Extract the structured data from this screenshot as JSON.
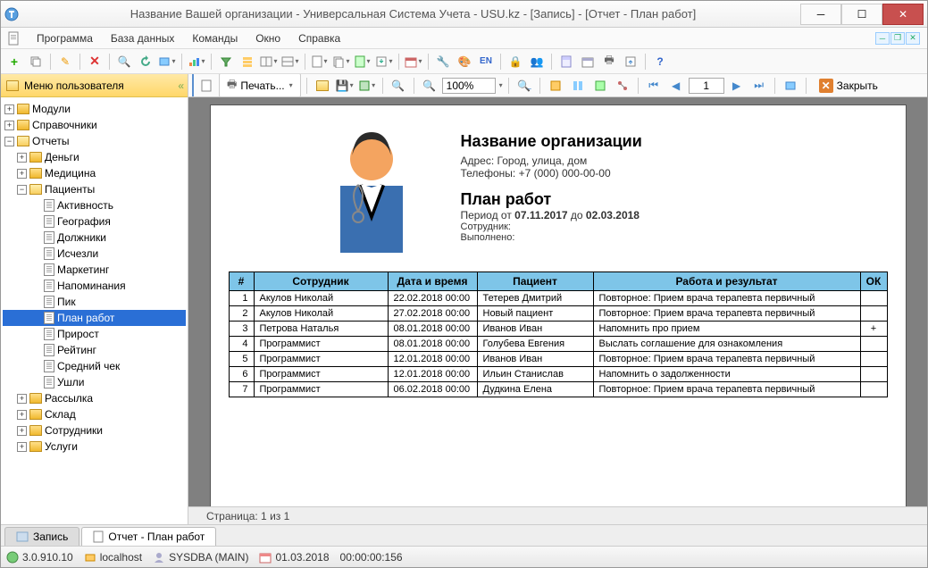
{
  "window": {
    "title": "Название Вашей организации - Универсальная Система Учета - USU.kz - [Запись] - [Отчет - План работ]"
  },
  "menu": [
    "Программа",
    "База данных",
    "Команды",
    "Окно",
    "Справка"
  ],
  "sidebar": {
    "title": "Меню пользователя",
    "nodes": {
      "modules": "Модули",
      "refs": "Справочники",
      "reports": "Отчеты",
      "money": "Деньги",
      "medicine": "Медицина",
      "patients": "Пациенты",
      "activity": "Активность",
      "geo": "География",
      "debtors": "Должники",
      "gone": "Исчезли",
      "marketing": "Маркетинг",
      "reminders": "Напоминания",
      "peak": "Пик",
      "plan": "План работ",
      "growth": "Прирост",
      "rating": "Рейтинг",
      "avgcheck": "Средний чек",
      "left": "Ушли",
      "mailing": "Рассылка",
      "warehouse": "Склад",
      "staff": "Сотрудники",
      "services": "Услуги"
    }
  },
  "report_toolbar": {
    "print": "Печать...",
    "zoom": "100%",
    "page": "1",
    "close": "Закрыть"
  },
  "report": {
    "org": "Название организации",
    "addr_label": "Адрес: ",
    "addr": "Город, улица, дом",
    "phone_label": "Телефоны: ",
    "phone": "+7 (000) 000-00-00",
    "title": "План работ",
    "period_prefix": "Период от ",
    "period_from": "07.11.2017",
    "period_mid": " до ",
    "period_to": "02.03.2018",
    "emp_label": "Сотрудник:",
    "done_label": "Выполнено:",
    "cols": {
      "num": "#",
      "emp": "Сотрудник",
      "dt": "Дата и время",
      "patient": "Пациент",
      "work": "Работа и результат",
      "ok": "ОК"
    },
    "rows": [
      {
        "n": "1",
        "emp": "Акулов Николай",
        "dt": "22.02.2018 00:00",
        "p": "Тетерев Дмитрий",
        "w": "Повторное: Прием врача терапевта первичный",
        "ok": ""
      },
      {
        "n": "2",
        "emp": "Акулов Николай",
        "dt": "27.02.2018 00:00",
        "p": "Новый пациент",
        "w": "Повторное: Прием врача терапевта первичный",
        "ok": ""
      },
      {
        "n": "3",
        "emp": "Петрова Наталья",
        "dt": "08.01.2018 00:00",
        "p": "Иванов Иван",
        "w": "Напомнить про прием",
        "ok": "+"
      },
      {
        "n": "4",
        "emp": "Программист",
        "dt": "08.01.2018 00:00",
        "p": "Голубева Евгения",
        "w": "Выслать соглашение для ознакомления",
        "ok": ""
      },
      {
        "n": "5",
        "emp": "Программист",
        "dt": "12.01.2018 00:00",
        "p": "Иванов Иван",
        "w": "Повторное: Прием врача терапевта первичный",
        "ok": ""
      },
      {
        "n": "6",
        "emp": "Программист",
        "dt": "12.01.2018 00:00",
        "p": "Ильин Станислав",
        "w": "Напомнить о задолженности",
        "ok": ""
      },
      {
        "n": "7",
        "emp": "Программист",
        "dt": "06.02.2018 00:00",
        "p": "Дудкина Елена",
        "w": "Повторное: Прием врача терапевта первичный",
        "ok": ""
      }
    ],
    "page_status": "Страница: 1 из 1"
  },
  "tabs": {
    "record": "Запись",
    "report": "Отчет - План работ"
  },
  "status": {
    "ver": "3.0.910.10",
    "host": "localhost",
    "user": "SYSDBA (MAIN)",
    "date": "01.03.2018",
    "time": "00:00:00:156"
  }
}
